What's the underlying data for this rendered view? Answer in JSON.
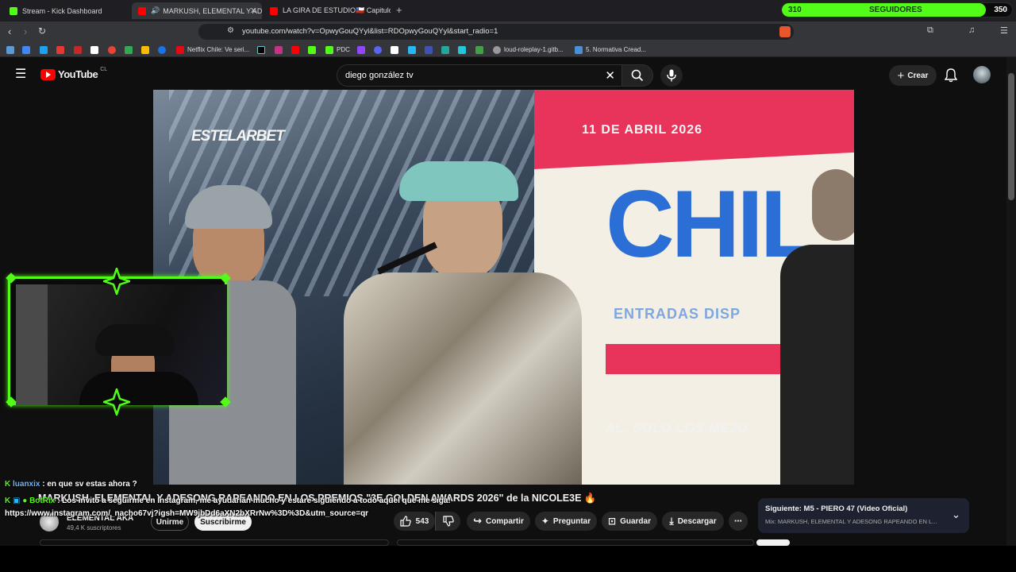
{
  "tabs": [
    {
      "title": "Stream - Kick Dashboard"
    },
    {
      "title": "MARKUSH, ELEMENTAL Y ADE"
    },
    {
      "title": "LA GIRA DE ESTUDIO🇨🇱 Capitulo"
    }
  ],
  "followers": {
    "current": "310",
    "label": "SEGUIDORES",
    "goal": "350",
    "progress": 0.886
  },
  "address": {
    "url": "youtube.com/watch?v=OpwyGouQYyl&list=RDOpwyGouQYyl&start_radio=1"
  },
  "bookmarks": [
    {
      "label": "Netflix Chile: Ve seri..."
    },
    {
      "label": "PDC"
    },
    {
      "label": "loud-roleplay-1.gitb..."
    },
    {
      "label": "5. Normativa Cread..."
    }
  ],
  "youtube": {
    "logo_text": "YouTube",
    "country": "CL",
    "search_value": "diego gonzález tv",
    "create_label": "Crear"
  },
  "video": {
    "title": "MARKUSH, ELEMENTAL Y ADESONG RAPEANDO EN LOS PREMIOS \"3E GOLDEN AWARDS 2026\" de la NICOLE3E 🔥",
    "sponsor": "ESTELARBET",
    "banner_text": "CHIL",
    "banner_sub": "ENTRADAS DISP",
    "banner_date": "11 DE ABRIL 2026",
    "bottom_text": "AL, SOLO LOS MEJO"
  },
  "channel": {
    "name": "ELEMENTAL AKA",
    "subscribers": "49,4 K suscriptores",
    "join_label": "Unirme",
    "subscribe_label": "Suscribirme"
  },
  "actions": {
    "likes": "543",
    "share": "Compartir",
    "ask": "Preguntar",
    "save": "Guardar",
    "download": "Descargar"
  },
  "next": {
    "label": "Siguiente: M5 - PIERO 47 (Video Oficial)",
    "mix": "Mix: MARKUSH, ELEMENTAL Y ADESONG RAPEANDO EN L..."
  },
  "chat": [
    {
      "user": "luanxix",
      "message": ": en que sv estas ahora ?"
    },
    {
      "user": "BotRix",
      "message": ": Los invito a seguirme en Instagram, me ayudarian mucho y estare siguiendo a todo aquel que me siga!"
    },
    {
      "user": "",
      "message": "https://www.instagram.com/_nacho67vj?igsh=MW9jbDd6aXN2bXRrNw%3D%3D&utm_source=qr"
    }
  ],
  "colors": {
    "kick_green": "#53fc18",
    "yt_red": "#ff0000",
    "bg": "#0f0f0f"
  }
}
